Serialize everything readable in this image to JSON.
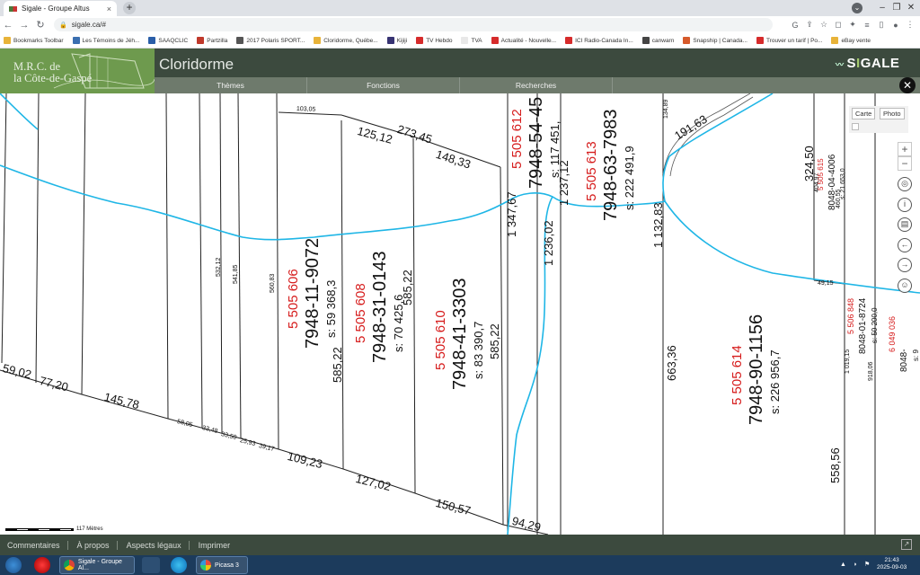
{
  "browser": {
    "tab_title": "Sigale - Groupe Altus",
    "tab_close": "×",
    "new_tab": "+",
    "url": "sigale.ca/#",
    "nav": {
      "back": "←",
      "forward": "→",
      "reload": "↻"
    },
    "window_controls": {
      "minimize": "–",
      "maximize": "❐",
      "close": "✕"
    },
    "bookmarks": [
      {
        "label": "Bookmarks Toolbar",
        "color": "#e8b339"
      },
      {
        "label": "Les Témoins de Jéh...",
        "color": "#3b6fb0"
      },
      {
        "label": "SAAQCLIC",
        "color": "#2a5ea8"
      },
      {
        "label": "Partzilla",
        "color": "#c0392b"
      },
      {
        "label": "2017 Polaris SPORT...",
        "color": "#555555"
      },
      {
        "label": "Cloridorme, Québe...",
        "color": "#e8b339"
      },
      {
        "label": "Kijiji",
        "color": "#373373"
      },
      {
        "label": "TV Hebdo",
        "color": "#d62b2b"
      },
      {
        "label": "TVA",
        "color": "#e8e8e8"
      },
      {
        "label": "Actualité - Nouvelle...",
        "color": "#d62b2b"
      },
      {
        "label": "ICI Radio-Canada In...",
        "color": "#d62b2b"
      },
      {
        "label": "canwarn",
        "color": "#444444"
      },
      {
        "label": "Snapship | Canada...",
        "color": "#d65a2b"
      },
      {
        "label": "Trouver un tarif | Po...",
        "color": "#d62b2b"
      },
      {
        "label": "eBay vente",
        "color": "#e8b339"
      }
    ]
  },
  "app": {
    "org_line1": "M.R.C. de",
    "org_line2": "la Côte-de-Gaspé",
    "title": "Cloridorme",
    "logo_prefix": "S",
    "logo_accent": "I",
    "logo_suffix": "GALE",
    "menu": [
      "Thèmes",
      "Fonctions",
      "Recherches"
    ],
    "close_label": "✕",
    "map_tools": {
      "carte": "Carte",
      "photo": "Photo"
    },
    "zoom_in": "+",
    "zoom_out": "−",
    "nav_icons": [
      "◎",
      "i",
      "▤",
      "←",
      "→",
      "☺"
    ],
    "scale_label": "117 Mètres",
    "footer": [
      "Commentaires",
      "À propos",
      "Aspects légaux",
      "Imprimer"
    ],
    "footer_icon": "↗"
  },
  "map": {
    "lots": [
      {
        "number": "5 505 606",
        "matricule": "7948-11-9072",
        "area": "s: 59 368,3"
      },
      {
        "number": "5 505 608",
        "matricule": "7948-31-0143",
        "area": "s: 70 425,6"
      },
      {
        "number": "5 505 610",
        "matricule": "7948-41-3303",
        "area": "s: 83 390,7"
      },
      {
        "number": "5 505 612",
        "matricule": "7948-54-45",
        "area": "s: 117 451,",
        "partial": true
      },
      {
        "number": "5 505 613",
        "matricule": "7948-63-7983",
        "area": "s: 222 491,9"
      },
      {
        "number": "5 505 614",
        "matricule": "7948-90-1156",
        "area": "s: 226 956,7"
      },
      {
        "number": "5 505 615",
        "matricule": "8048-04-4006",
        "area": "s: 21 653,0"
      },
      {
        "number": "5 506 848",
        "matricule": "8048-01-8724",
        "area": "s: 50 200,0"
      },
      {
        "number": "6 049 036",
        "matricule": "8048-",
        "area": "s: 9",
        "partial": true
      }
    ],
    "dimensions": {
      "bottom_edge": [
        "59,02",
        "77,20",
        "145,78",
        "58,05",
        "33,48",
        "33,50",
        "25,93",
        "39,17",
        "109,23",
        "127,02",
        "150,57",
        "94,29"
      ],
      "top_edge": [
        "103,05",
        "125,12",
        "273,45",
        "148,33",
        "191,63",
        "134,89"
      ],
      "vertical": [
        "532,12",
        "541,85",
        "560,83",
        "585,22",
        "585,22",
        "585,22",
        "1 347,67",
        "1 236,02",
        "1 237,12",
        "1 132,83",
        "663,36",
        "324,50",
        "49,15",
        "404,97",
        "460,55",
        "1 019,15",
        "918,06",
        "558,56"
      ]
    }
  },
  "taskbar": {
    "tasks": [
      "Sigale - Groupe Al...",
      "Picasa 3"
    ],
    "time": "21:43",
    "date": "2025-09-03",
    "tray": "▲ ◗ ⚑"
  }
}
